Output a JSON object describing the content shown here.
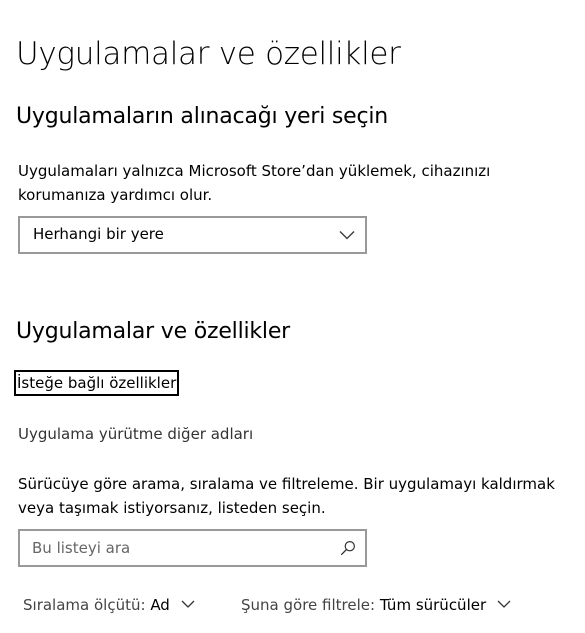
{
  "page": {
    "title": "Uygulamalar ve özellikler"
  },
  "install_source": {
    "heading": "Uygulamaların alınacağı yeri seçin",
    "description_line1": "Uygulamaları yalnızca Microsoft Store’dan yüklemek, cihazınızı",
    "description_line2": "korumanıza yardımcı olur.",
    "dropdown_value": "Herhangi bir yere",
    "dropdown_icon": "chevron-down-icon"
  },
  "apps": {
    "heading": "Uygulamalar ve özellikler",
    "optional_features_link": "İsteğe bağlı özellikler",
    "app_aliases_link": "Uygulama yürütme diğer adları",
    "description_line1": "Sürücüye göre arama, sıralama ve filtreleme. Bir uygulamayı kaldırmak",
    "description_line2": "veya taşımak istiyorsanız, listeden seçin.",
    "search_placeholder": "Bu listeyi ara",
    "search_icon": "search-icon",
    "sort_label": "Sıralama ölçütü:",
    "sort_value": "Ad",
    "filter_label": "Şuna göre filtrele:",
    "filter_value": "Tüm sürücüler"
  },
  "colors": {
    "border": "#999999",
    "focus_border": "#000000",
    "text": "#000000",
    "secondary_text": "#444444"
  }
}
